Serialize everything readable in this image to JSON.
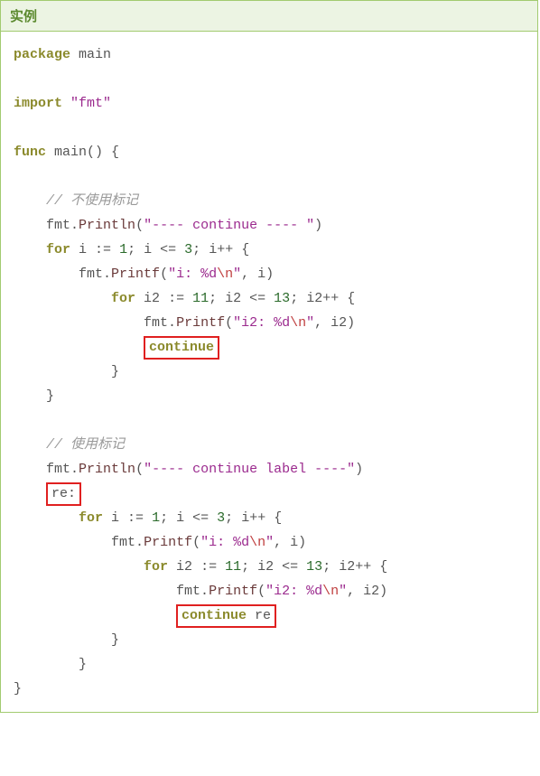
{
  "header": {
    "title": "实例"
  },
  "code": {
    "package_kw": "package",
    "package_name": " main",
    "import_kw": "import",
    "import_val": "\"fmt\"",
    "func_kw": "func",
    "func_name": " main",
    "func_parens": "()",
    "brace_open": " {",
    "brace_close": "}",
    "comment1": "// 不使用标记",
    "line_fmt": "fmt",
    "dot": ".",
    "println": "Println",
    "printf": "Printf",
    "str_cont1": "\"---- continue ---- \"",
    "for_kw": "for",
    "i_init": " i ",
    "assign": ":=",
    "sp": " ",
    "one": "1",
    "semi": ";",
    "i_le": " i ",
    "le": "<=",
    "three": "3",
    "ipp": " i++ ",
    "brace_o": "{",
    "str_i": "\"i: %d",
    "esc_n": "\\n",
    "str_close": "\"",
    "comma_i": ", i",
    "paren_close": ")",
    "i2_init": " i2 ",
    "eleven": "11",
    "thirteen": "13",
    "i2pp": " i2++ ",
    "str_i2": "\"i2: %d",
    "comma_i2": ", i2",
    "continue_kw": "continue",
    "comment2": "// 使用标记",
    "str_cont2": "\"---- continue label ----\"",
    "re_label_name": "re",
    "re_colon": ":",
    "continue_re": "continue",
    "re_ident": " re"
  }
}
